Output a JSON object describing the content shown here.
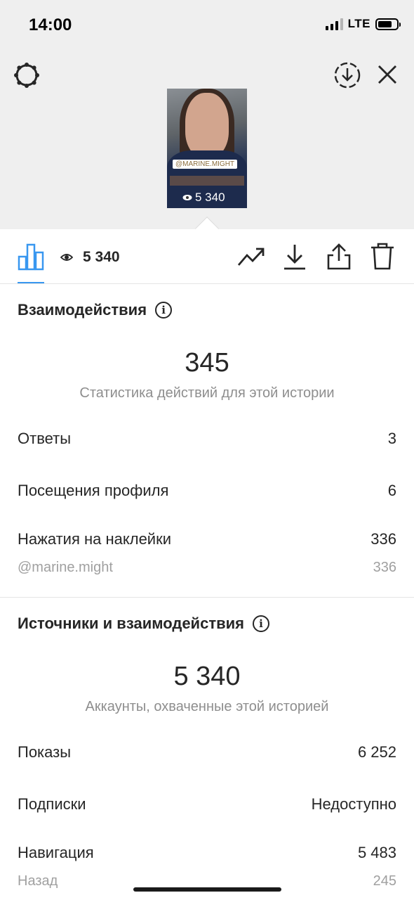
{
  "status_bar": {
    "time": "14:00",
    "network": "LTE"
  },
  "story_preview": {
    "mention": "@MARINE.MIGHT",
    "views": "5 340"
  },
  "toolbar": {
    "views": "5 340"
  },
  "interactions": {
    "title": "Взаимодействия",
    "total": "345",
    "subtitle": "Статистика действий для этой истории",
    "rows": [
      {
        "label": "Ответы",
        "value": "3"
      },
      {
        "label": "Посещения профиля",
        "value": "6"
      },
      {
        "label": "Нажатия на наклейки",
        "value": "336"
      }
    ],
    "sticker_detail": {
      "label": "@marine.might",
      "value": "336"
    }
  },
  "discovery": {
    "title": "Источники и взаимодействия",
    "total": "5 340",
    "subtitle": "Аккаунты, охваченные этой историей",
    "rows": [
      {
        "label": "Показы",
        "value": "6 252"
      },
      {
        "label": "Подписки",
        "value": "Недоступно"
      },
      {
        "label": "Навигация",
        "value": "5 483"
      }
    ],
    "nav_detail": {
      "label": "Назад",
      "value": "245"
    }
  },
  "colors": {
    "accent": "#3897f0",
    "text": "#262626",
    "secondary": "#8e8e8e",
    "header_bg": "#efefef"
  },
  "icons": [
    "settings-icon",
    "download-circle-icon",
    "close-icon",
    "insights-bar-chart-icon",
    "eye-icon",
    "promote-trend-icon",
    "download-icon",
    "share-icon",
    "trash-icon",
    "info-icon"
  ]
}
